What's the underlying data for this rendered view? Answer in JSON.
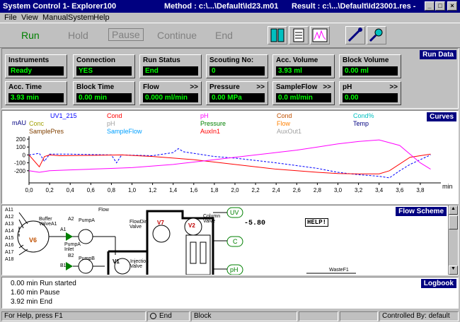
{
  "window": {
    "title": "System Control 1- Explorer100",
    "method": "Method : c:\\...\\Default\\Id23.m01",
    "result": "Result : c:\\...\\Default\\Id23001.res -",
    "minimize": "_",
    "maximize": "□",
    "close": "×"
  },
  "menu": [
    "File",
    "View",
    "Manual",
    "System",
    "Help"
  ],
  "toolbar": {
    "run": "Run",
    "hold": "Hold",
    "pause": "Pause",
    "continue": "Continue",
    "end": "End"
  },
  "rundata": {
    "tag": "Run Data",
    "boxes": [
      {
        "label": "Instruments",
        "value": "Ready"
      },
      {
        "label": "Connection",
        "value": "YES"
      },
      {
        "label": "Run Status",
        "value": "End"
      },
      {
        "label": "Scouting No:",
        "value": "0"
      },
      {
        "label": "Acc. Volume",
        "value": "3.93 ml"
      },
      {
        "label": "Block Volume",
        "value": "0.00 ml"
      },
      {
        "label": "Acc. Time",
        "value": "3.93 min"
      },
      {
        "label": "Block Time",
        "value": "0.00 min"
      },
      {
        "label": "Flow",
        "value": "0.000 ml/min",
        "arrow": ">>"
      },
      {
        "label": "Pressure",
        "value": "0.00 MPa",
        "arrow": ">>"
      },
      {
        "label": "SampleFlow",
        "value": "0.0 ml/min",
        "arrow": ">>"
      },
      {
        "label": "pH",
        "value": "0.00",
        "arrow": ">>"
      }
    ]
  },
  "curves": {
    "tag": "Curves",
    "yunit": "mAU",
    "xunit": "min",
    "legend": [
      {
        "name": "UV1_215",
        "color": "#0000ff"
      },
      {
        "name": "Cond",
        "color": "#ff0000"
      },
      {
        "name": "pH",
        "color": "#ff00ff"
      },
      {
        "name": "Cond",
        "color": "#c05000"
      },
      {
        "name": "Cond%",
        "color": "#00c0c0"
      },
      {
        "name": "Conc",
        "color": "#a0a000"
      },
      {
        "name": "pH",
        "color": "#a0a0a0"
      },
      {
        "name": "Pressure",
        "color": "#008000"
      },
      {
        "name": "Flow",
        "color": "#ff8000"
      },
      {
        "name": "Temp",
        "color": "#000080"
      },
      {
        "name": "SamplePres",
        "color": "#804000"
      },
      {
        "name": "SampleFlow",
        "color": "#00a0ff"
      },
      {
        "name": "AuxIn1",
        "color": "#ff0000"
      },
      {
        "name": "AuxOut1",
        "color": "#a0a0a0"
      }
    ]
  },
  "chart_data": {
    "type": "line",
    "xlabel": "min",
    "ylabel": "mAU",
    "xlim": [
      0,
      4.0
    ],
    "ylim": [
      -300,
      200
    ],
    "xticks": [
      "0,0",
      "0,2",
      "0,4",
      "0,6",
      "0,8",
      "1,0",
      "1,2",
      "1,4",
      "1,6",
      "1,8",
      "2,0",
      "2,2",
      "2,4",
      "2,6",
      "2,8",
      "3,0",
      "3,2",
      "3,4",
      "3,6",
      "3,8"
    ],
    "yticks": [
      "200",
      "100",
      "0",
      "-100",
      "-200"
    ],
    "series": [
      {
        "name": "UV1_215",
        "color": "#0000ff",
        "x": [
          0,
          0.1,
          0.15,
          0.2,
          0.4,
          0.8,
          0.85,
          0.9,
          1.2,
          1.4,
          1.45,
          1.5,
          1.6,
          1.7,
          1.8,
          2.0,
          2.4,
          2.8,
          3.0,
          3.2,
          3.4,
          3.5,
          3.6,
          3.7,
          3.8,
          3.9
        ],
        "y": [
          0,
          20,
          -80,
          10,
          10,
          0,
          -100,
          0,
          -10,
          30,
          80,
          40,
          20,
          0,
          -20,
          -40,
          -100,
          -170,
          -220,
          -250,
          -270,
          -290,
          -200,
          -120,
          -60,
          0
        ]
      },
      {
        "name": "Cond",
        "color": "#ff0000",
        "x": [
          0,
          0.1,
          0.15,
          0.2,
          0.3,
          0.6,
          0.9,
          1.2,
          1.6,
          2.0,
          2.4,
          2.8,
          3.0,
          3.2,
          3.4,
          3.5,
          3.7,
          3.9
        ],
        "y": [
          0,
          -150,
          -20,
          0,
          -10,
          -5,
          0,
          -20,
          -60,
          -120,
          -180,
          -220,
          -235,
          -240,
          -240,
          -200,
          -30,
          10
        ]
      },
      {
        "name": "pH",
        "color": "#ff00ff",
        "x": [
          0,
          0.1,
          0.2,
          0.4,
          0.6,
          0.8,
          1.0,
          1.2,
          1.4,
          1.6,
          1.8,
          2.0,
          2.2,
          2.4,
          2.6,
          2.8,
          3.0,
          3.2,
          3.4,
          3.6,
          3.8,
          3.9
        ],
        "y": [
          -200,
          -220,
          -200,
          -190,
          -180,
          -170,
          -160,
          -140,
          -120,
          -90,
          -60,
          -30,
          0,
          30,
          60,
          100,
          140,
          170,
          190,
          120,
          -100,
          -180
        ]
      }
    ]
  },
  "flow": {
    "tag": "Flow Scheme",
    "ports": [
      "A11",
      "A12",
      "A13",
      "A14",
      "A15",
      "A16",
      "A17",
      "A18"
    ],
    "buffer_valve": "Buffer ValveA1",
    "v6": "V6",
    "a1": "A1",
    "a2": "A2",
    "pumpa": "PumpA",
    "pumpa_inlet": "PumpA Inlet",
    "b1": "B1",
    "b2": "B2",
    "pumpb": "PumpB",
    "flow_label": "Flow",
    "v1": "V1",
    "injection_valve": "Injection Valve",
    "flowdir_valve": "FlowDir Valve",
    "v7": "V7",
    "v2": "V2",
    "column_valve": "Column Valve",
    "uv": "UV",
    "c": "C",
    "ph": "pH",
    "uv_value": "-5.80",
    "help": "HELP!",
    "waste": "WasteF1"
  },
  "logbook": {
    "tag": "Logbook",
    "lines": [
      "0.00 min Run started",
      "1.60 min Pause",
      "3.92 min End"
    ]
  },
  "status": {
    "help": "For Help, press F1",
    "end": "End",
    "block": "Block",
    "controlled": "Controlled By: default"
  }
}
